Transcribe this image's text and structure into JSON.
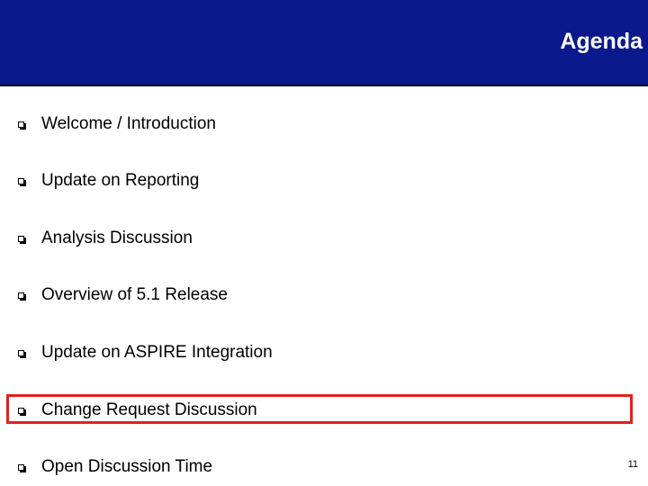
{
  "slide": {
    "title": "Agenda",
    "page_number": "11",
    "highlight_color": "#e02020",
    "header_color": "#0a1a8c",
    "bullet_icon": "hollow-square-bullet-icon"
  },
  "agenda": {
    "items": [
      {
        "label": "Welcome / Introduction"
      },
      {
        "label": "Update on Reporting"
      },
      {
        "label": "Analysis Discussion"
      },
      {
        "label": "Overview of 5.1 Release"
      },
      {
        "label": "Update on ASPIRE Integration"
      },
      {
        "label": "Change Request Discussion",
        "highlighted": true
      },
      {
        "label": "Open Discussion Time"
      }
    ]
  }
}
